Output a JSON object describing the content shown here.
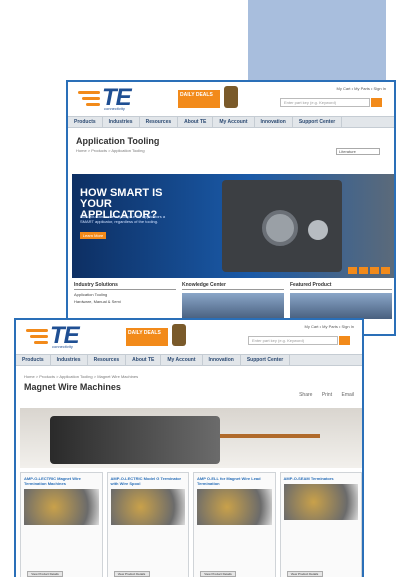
{
  "brand": {
    "name": "TE",
    "tagline": "connectivity",
    "accent": "#f28a1a",
    "primary": "#1f4f93"
  },
  "header": {
    "promo": "DAILY DEALS",
    "tools": "My Cart • My Parts • Sign In",
    "search_placeholder": "Enter part key (e.g. Keyword)"
  },
  "nav": [
    "Products",
    "Industries",
    "Resources",
    "About TE",
    "My Account",
    "Innovation",
    "Support Center"
  ],
  "back_page": {
    "title": "Application Tooling",
    "breadcrumb": "Home > Products > Application Tooling",
    "select": "Literature",
    "hero": {
      "heading": "HOW SMART IS YOUR APPLICATOR?",
      "body": "Now you can make any of your TE Applicators a SMART applicator, regardless of the tooling.",
      "button": "Learn More"
    },
    "sections": [
      {
        "title": "Industry Solutions",
        "line": "Application Tooling",
        "line2": "Hardware, Manual & Semi"
      },
      {
        "title": "Knowledge Center",
        "line": "",
        "line2": ""
      },
      {
        "title": "Featured Product",
        "line": "",
        "line2": ""
      }
    ]
  },
  "front_page": {
    "title": "Magnet Wire Machines",
    "breadcrumb": "Home > Products > Application Tooling > Magnet Wire Machines",
    "actions": [
      "Share",
      "Print",
      "Email"
    ],
    "products": [
      {
        "name": "AMP-O-LECTRIC Magnet Wire Termination Machines",
        "button": "View Product Details"
      },
      {
        "name": "AMP-O-LECTRIC Model G Terminator with Wire Spool",
        "button": "View Product Details"
      },
      {
        "name": "AMP O-ELL for Magnet Wire Lead Termination",
        "button": "View Product Details"
      },
      {
        "name": "AMP-O-SEAM Terminators",
        "button": "View Product Details"
      }
    ]
  }
}
